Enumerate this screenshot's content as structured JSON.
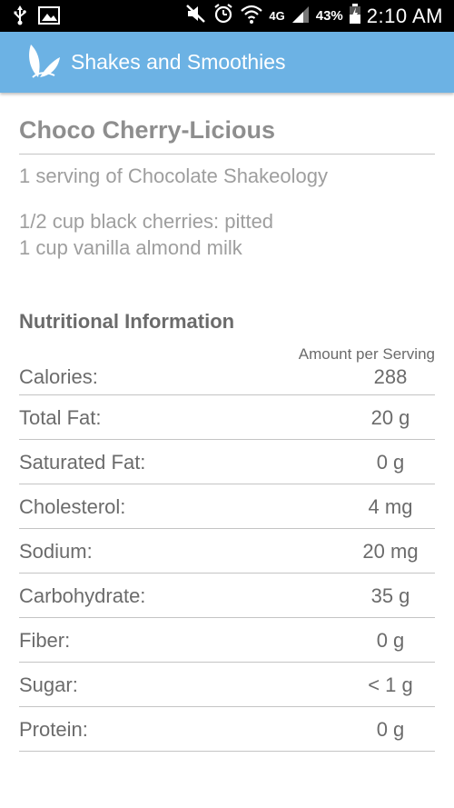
{
  "status_bar": {
    "icons_left": [
      "usb-icon",
      "image-icon"
    ],
    "icons_right": [
      "mute-icon",
      "alarm-icon",
      "wifi-icon",
      "signal-icon",
      "battery-icon"
    ],
    "network": "4G",
    "battery": "43%",
    "time": "2:10 AM"
  },
  "app_bar": {
    "title": "Shakes and Smoothies",
    "logo_icon": "leaf-icon",
    "color": "#6cb2e4"
  },
  "recipe": {
    "title": "Choco Cherry-Licious",
    "serving": "1 serving of Chocolate Shakeology",
    "ingredients": [
      "1/2 cup black cherries: pitted",
      "1 cup vanilla almond milk"
    ]
  },
  "nutrition": {
    "heading": "Nutritional Information",
    "amount_header": "Amount per Serving",
    "rows": [
      {
        "label": "Calories:",
        "value": "288"
      },
      {
        "label": "Total Fat:",
        "value": "20 g"
      },
      {
        "label": "Saturated Fat:",
        "value": "0 g"
      },
      {
        "label": "Cholesterol:",
        "value": "4 mg"
      },
      {
        "label": "Sodium:",
        "value": "20 mg"
      },
      {
        "label": "Carbohydrate:",
        "value": "35 g"
      },
      {
        "label": "Fiber:",
        "value": "0 g"
      },
      {
        "label": "Sugar:",
        "value": "< 1 g"
      },
      {
        "label": "Protein:",
        "value": "0 g"
      }
    ]
  }
}
